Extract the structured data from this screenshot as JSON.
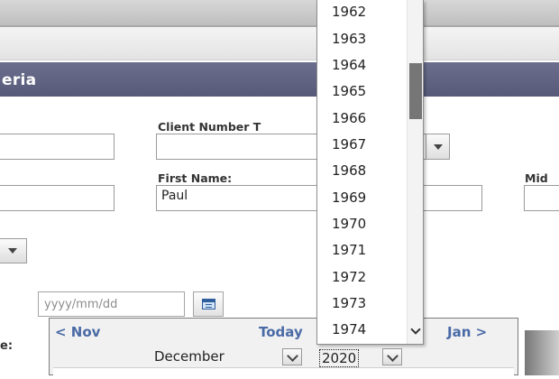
{
  "header": {
    "title": "eria"
  },
  "fields": {
    "client_number_type_label": "Client Number T",
    "first_name_label": "First Name:",
    "first_name_value": "Paul",
    "middle_label": "Mid",
    "date_placeholder": "yyyy/mm/dd",
    "date_side_label": "e:"
  },
  "calendar": {
    "prev_label": "< Nov",
    "today_label": "Today",
    "next_label": "Jan >",
    "month": "December",
    "year": "2020"
  },
  "year_dropdown": {
    "options": [
      "1962",
      "1963",
      "1964",
      "1965",
      "1966",
      "1967",
      "1968",
      "1969",
      "1970",
      "1971",
      "1972",
      "1973",
      "1974"
    ]
  },
  "colors": {
    "header_bg": "#5f6382",
    "nav_link": "#4a6aa6"
  }
}
